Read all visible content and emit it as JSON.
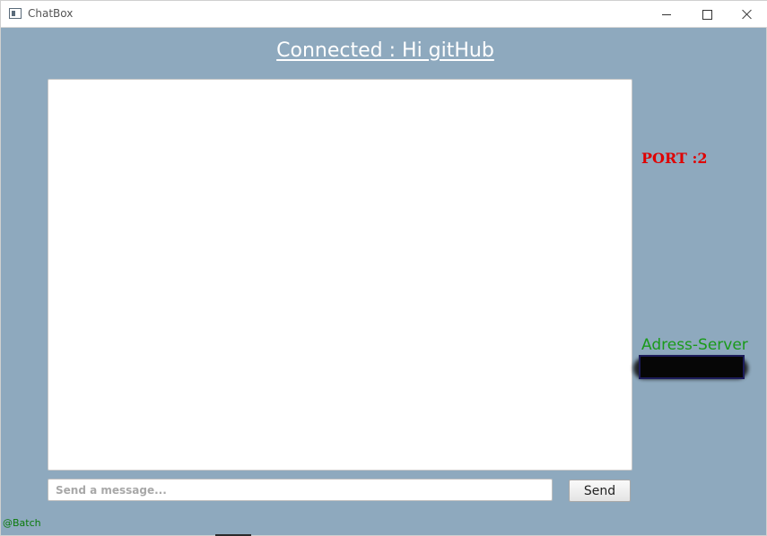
{
  "window": {
    "title": "ChatBox",
    "controls": [
      "minimize",
      "maximize",
      "close"
    ]
  },
  "header": {
    "title": "Connected : Hi gitHub"
  },
  "sidebar": {
    "port_label": "PORT :2",
    "server_label": "Adress-Server",
    "server_value": ""
  },
  "composer": {
    "placeholder": "Send a message...",
    "value": "",
    "send_label": "Send"
  },
  "footer": {
    "credit": "@Batch"
  },
  "colors": {
    "background": "#8ea9be",
    "port": "#e00000",
    "server": "#1a9a1a",
    "credit": "#0a7a0a",
    "title": "#ffffff"
  },
  "icons": {
    "app": "window-app-icon",
    "minimize": "minimize-icon",
    "maximize": "maximize-icon",
    "close": "close-icon"
  }
}
